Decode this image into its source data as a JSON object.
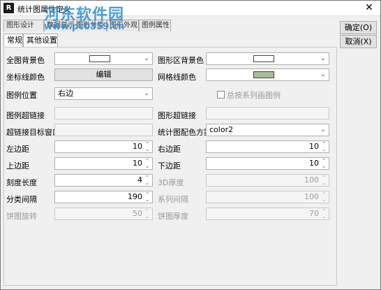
{
  "window": {
    "app_icon": "R",
    "title": "统计图属性定义",
    "close_glyph": "✕"
  },
  "watermark": {
    "line1": "河东软件园",
    "line2": "www.pc0359.cn"
  },
  "tabs": [
    "图形设计",
    "数据显示",
    "图形分类",
    "图形外观",
    "图例属性"
  ],
  "subtabs": [
    "常规",
    "其他设置"
  ],
  "buttons": {
    "ok": "确定(O)",
    "cancel": "取消(X)"
  },
  "form": {
    "bg_color_label": "全图背景色",
    "bg_color": "#ffffff",
    "plot_bg_color_label": "图形区背景色",
    "plot_bg_color": "#ffffff",
    "axis_color_label": "坐标线颜色",
    "axis_color_button": "编辑",
    "grid_color_label": "网格线颜色",
    "grid_color": "#a9bd95",
    "legend_pos_label": "图例位置",
    "legend_pos_value": "右边",
    "total_series_label": "总按系列画图例",
    "total_series_checked": false,
    "legend_link_label": "图例超链接",
    "legend_link_value": "",
    "plot_link_label": "图形超链接",
    "plot_link_value": "",
    "link_target_label": "超链接目标窗口",
    "link_target_value": "",
    "color_scheme_label": "统计图配色方案",
    "color_scheme_value": "color2",
    "left_margin_label": "左边距",
    "left_margin_value": "10",
    "right_margin_label": "右边距",
    "right_margin_value": "10",
    "top_margin_label": "上边距",
    "top_margin_value": "10",
    "bottom_margin_label": "下边距",
    "bottom_margin_value": "10",
    "tick_len_label": "刻度长度",
    "tick_len_value": "4",
    "depth_3d_label": "3D厚度",
    "depth_3d_value": "100",
    "cat_gap_label": "分类间隔",
    "cat_gap_value": "190",
    "series_gap_label": "系列间隔",
    "series_gap_value": "100",
    "pie_rot_label": "饼图旋转",
    "pie_rot_value": "50",
    "pie_thick_label": "饼图厚度",
    "pie_thick_value": "70"
  }
}
